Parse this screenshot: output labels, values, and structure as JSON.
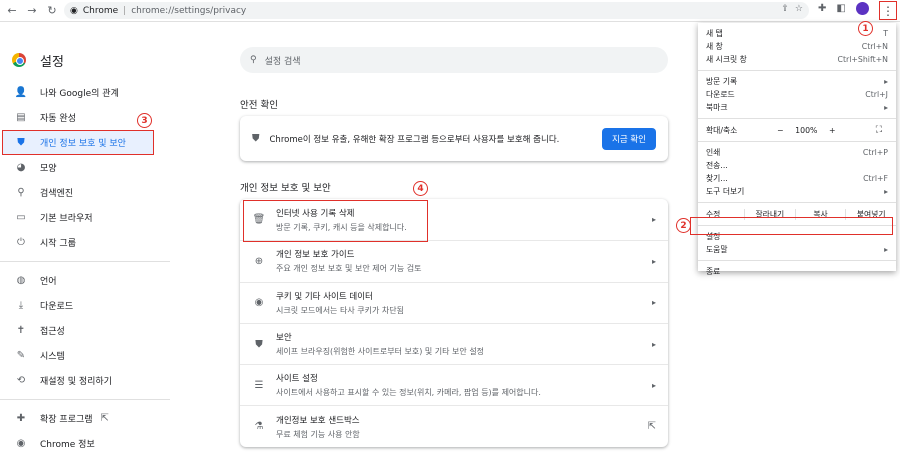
{
  "toolbar": {
    "site_label": "Chrome",
    "url": "chrome://settings/privacy"
  },
  "sidebar": {
    "title": "설정",
    "items": [
      {
        "label": "나와 Google의 관계",
        "icon": "person-icon"
      },
      {
        "label": "자동 완성",
        "icon": "autofill-icon"
      },
      {
        "label": "개인 정보 보호 및 보안",
        "icon": "shield-icon",
        "active": true
      },
      {
        "label": "모양",
        "icon": "palette-icon"
      },
      {
        "label": "검색엔진",
        "icon": "search-icon"
      },
      {
        "label": "기본 브라우저",
        "icon": "browser-icon"
      },
      {
        "label": "시작 그룹",
        "icon": "power-icon"
      }
    ],
    "items2": [
      {
        "label": "언어",
        "icon": "globe-icon"
      },
      {
        "label": "다운로드",
        "icon": "download-icon"
      },
      {
        "label": "접근성",
        "icon": "accessibility-icon"
      },
      {
        "label": "시스템",
        "icon": "wrench-icon"
      },
      {
        "label": "재설정 및 정리하기",
        "icon": "history-icon"
      }
    ],
    "items3": [
      {
        "label": "확장 프로그램",
        "icon": "puzzle-icon"
      },
      {
        "label": "Chrome 정보",
        "icon": "chrome-icon"
      }
    ]
  },
  "main": {
    "search_placeholder": "설정 검색",
    "safety_heading": "안전 확인",
    "safety_text": "Chrome이 정보 유출, 유해한 확장 프로그램 등으로부터 사용자를 보호해 줍니다.",
    "safety_button": "지금 확인",
    "privacy_heading": "개인 정보 보호 및 보안",
    "privacy_rows": [
      {
        "title": "인터넷 사용 기록 삭제",
        "sub": "방문 기록, 쿠키, 캐시 등을 삭제합니다.",
        "icon": "trash-icon"
      },
      {
        "title": "개인 정보 보호 가이드",
        "sub": "주요 개인 정보 보호 및 보안 제어 기능 검토",
        "icon": "guide-icon"
      },
      {
        "title": "쿠키 및 기타 사이트 데이터",
        "sub": "시크릿 모드에서는 타사 쿠키가 차단됨",
        "icon": "cookie-icon"
      },
      {
        "title": "보안",
        "sub": "세이프 브라우징(위험한 사이트로부터 보호) 및 기타 보안 설정",
        "icon": "security-icon"
      },
      {
        "title": "사이트 설정",
        "sub": "사이트에서 사용하고 표시할 수 있는 정보(위치, 카메라, 팝업 등)를 제어합니다.",
        "icon": "sliders-icon"
      },
      {
        "title": "개인정보 보호 샌드박스",
        "sub": "무료 체험 기능 사용 안함",
        "icon": "flask-icon"
      }
    ]
  },
  "menu": {
    "items_a": [
      {
        "label": "새 탭",
        "sc": "T"
      },
      {
        "label": "새 창",
        "sc": "Ctrl+N"
      },
      {
        "label": "새 시크릿 창",
        "sc": "Ctrl+Shift+N"
      }
    ],
    "items_b": [
      {
        "label": "방문 기록",
        "sc": "▸"
      },
      {
        "label": "다운로드",
        "sc": "Ctrl+J"
      },
      {
        "label": "북마크",
        "sc": "▸"
      }
    ],
    "zoom_label": "확대/축소",
    "zoom_minus": "−",
    "zoom_value": "100%",
    "zoom_plus": "+",
    "items_c": [
      {
        "label": "인쇄",
        "sc": "Ctrl+P"
      },
      {
        "label": "전송...",
        "sc": ""
      },
      {
        "label": "찾기...",
        "sc": "Ctrl+F"
      },
      {
        "label": "도구 더보기",
        "sc": "▸"
      }
    ],
    "edit_label": "수정",
    "cut": "잘라내기",
    "copy": "복사",
    "paste": "붙여넣기",
    "settings": "설정",
    "help": "도움말",
    "exit": "종료"
  },
  "markers": [
    "1",
    "2",
    "3",
    "4"
  ],
  "colors": {
    "accent": "#1a73e8",
    "annotation": "#e0302a"
  }
}
